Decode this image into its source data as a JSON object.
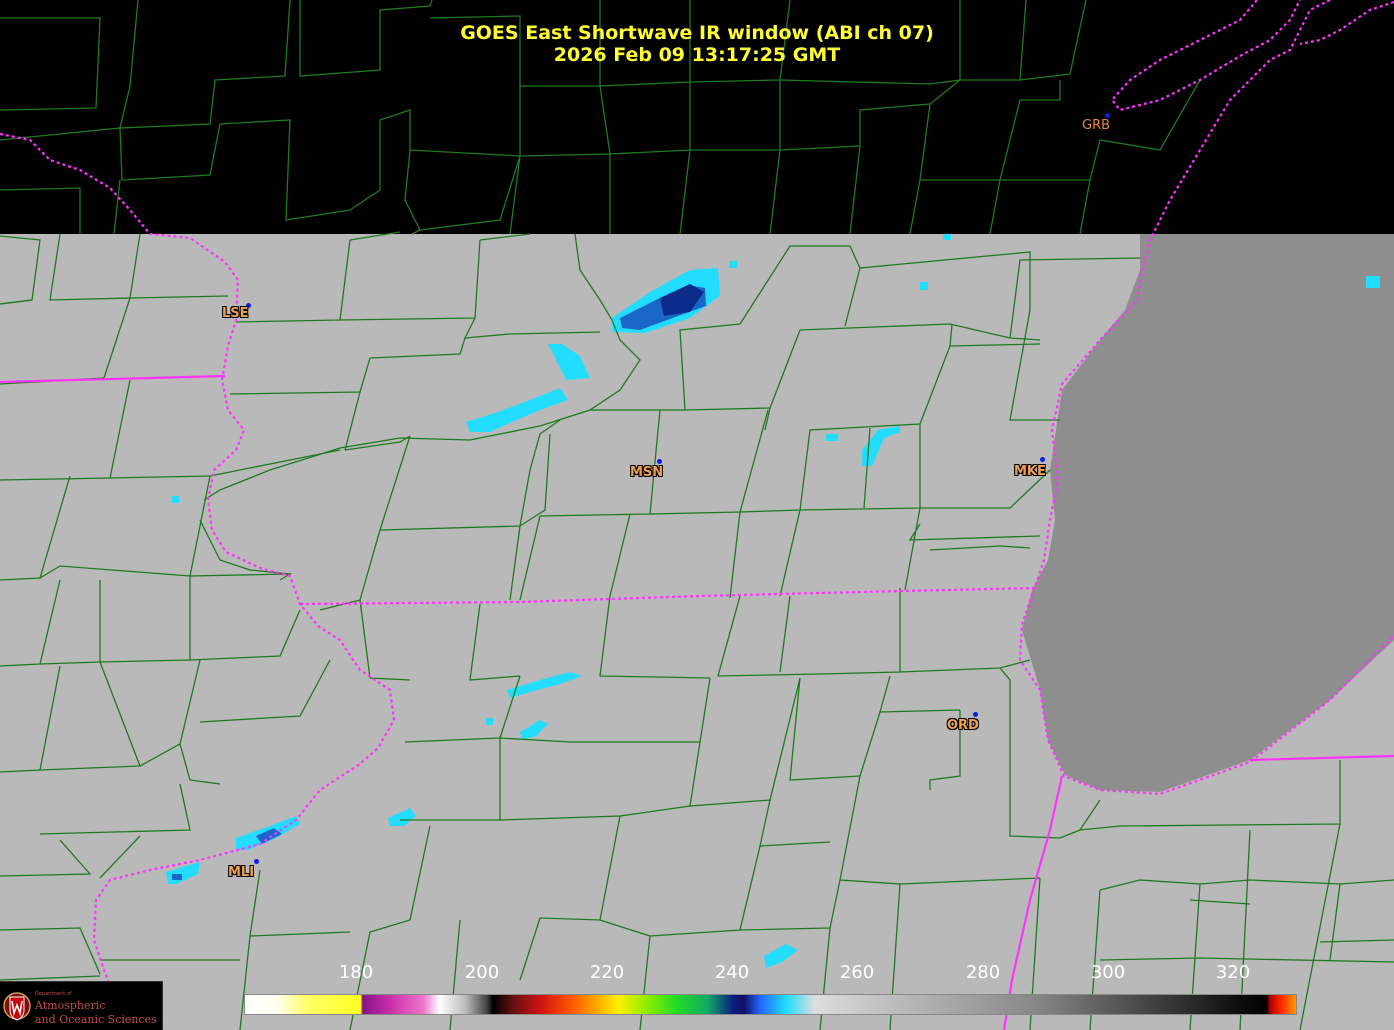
{
  "title": {
    "line1": "GOES East Shortwave IR window (ABI ch 07)",
    "line2": "2026 Feb 09  13:17:25 GMT"
  },
  "stations": [
    {
      "id": "GRB",
      "label": "GRB"
    },
    {
      "id": "LSE",
      "label": "LSE"
    },
    {
      "id": "MSN",
      "label": "MSN"
    },
    {
      "id": "MKE",
      "label": "MKE"
    },
    {
      "id": "ORD",
      "label": "ORD"
    },
    {
      "id": "MLI",
      "label": "MLI"
    }
  ],
  "colorbar": {
    "tick_labels": [
      "180",
      "200",
      "220",
      "240",
      "260",
      "280",
      "300",
      "320"
    ],
    "colors": {
      "cold_yellow": "#ffff22",
      "magenta": "#cc33aa",
      "green": "#22dd22",
      "cyan": "#22ddff",
      "blue_dark": "#0b1a80",
      "warm_gray_black": "#111111",
      "hot_red": "#ff2200"
    }
  },
  "map": {
    "colors": {
      "county_lines": "#1f7a1f",
      "state_borders": "#ff33ff",
      "land_gray": "#b8b8b8",
      "lake_gray": "#8a8a8a",
      "cloud_cyan": "#22ddff",
      "cloud_blue": "#1040a0"
    }
  },
  "logo": {
    "small_text": "Department of",
    "line1": "Atmospheric",
    "line2": "and Oceanic Sciences"
  }
}
